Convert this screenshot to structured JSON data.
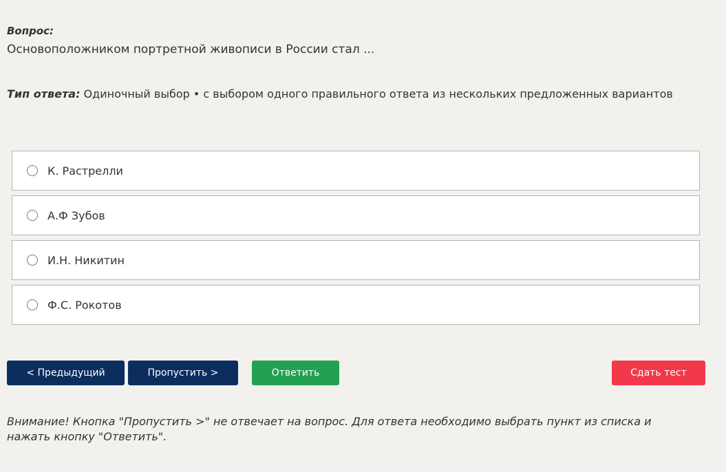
{
  "question": {
    "label": "Вопрос:",
    "text": "Основоположником портретной живописи в России стал ..."
  },
  "answer_type": {
    "label": "Тип ответа:",
    "value": " Одиночный выбор • с выбором одного правильного ответа из нескольких предложенных вариантов"
  },
  "options": [
    {
      "label": "К. Растрелли",
      "selected": false
    },
    {
      "label": "А.Ф Зубов",
      "selected": false
    },
    {
      "label": "И.Н. Никитин",
      "selected": false
    },
    {
      "label": "Ф.С. Рокотов",
      "selected": false
    }
  ],
  "buttons": {
    "prev": "< Предыдущий",
    "skip": "Пропустить >",
    "answer": "Ответить",
    "submit": "Сдать тест"
  },
  "notice": "Внимание! Кнопка \"Пропустить >\" не отвечает на вопрос. Для ответа необходимо выбрать пункт из списка и нажать кнопку \"Ответить\".",
  "colors": {
    "background": "#f2f1ee",
    "nav_button": "#0b2e5e",
    "answer_button": "#24a052",
    "submit_button": "#f2394c"
  }
}
